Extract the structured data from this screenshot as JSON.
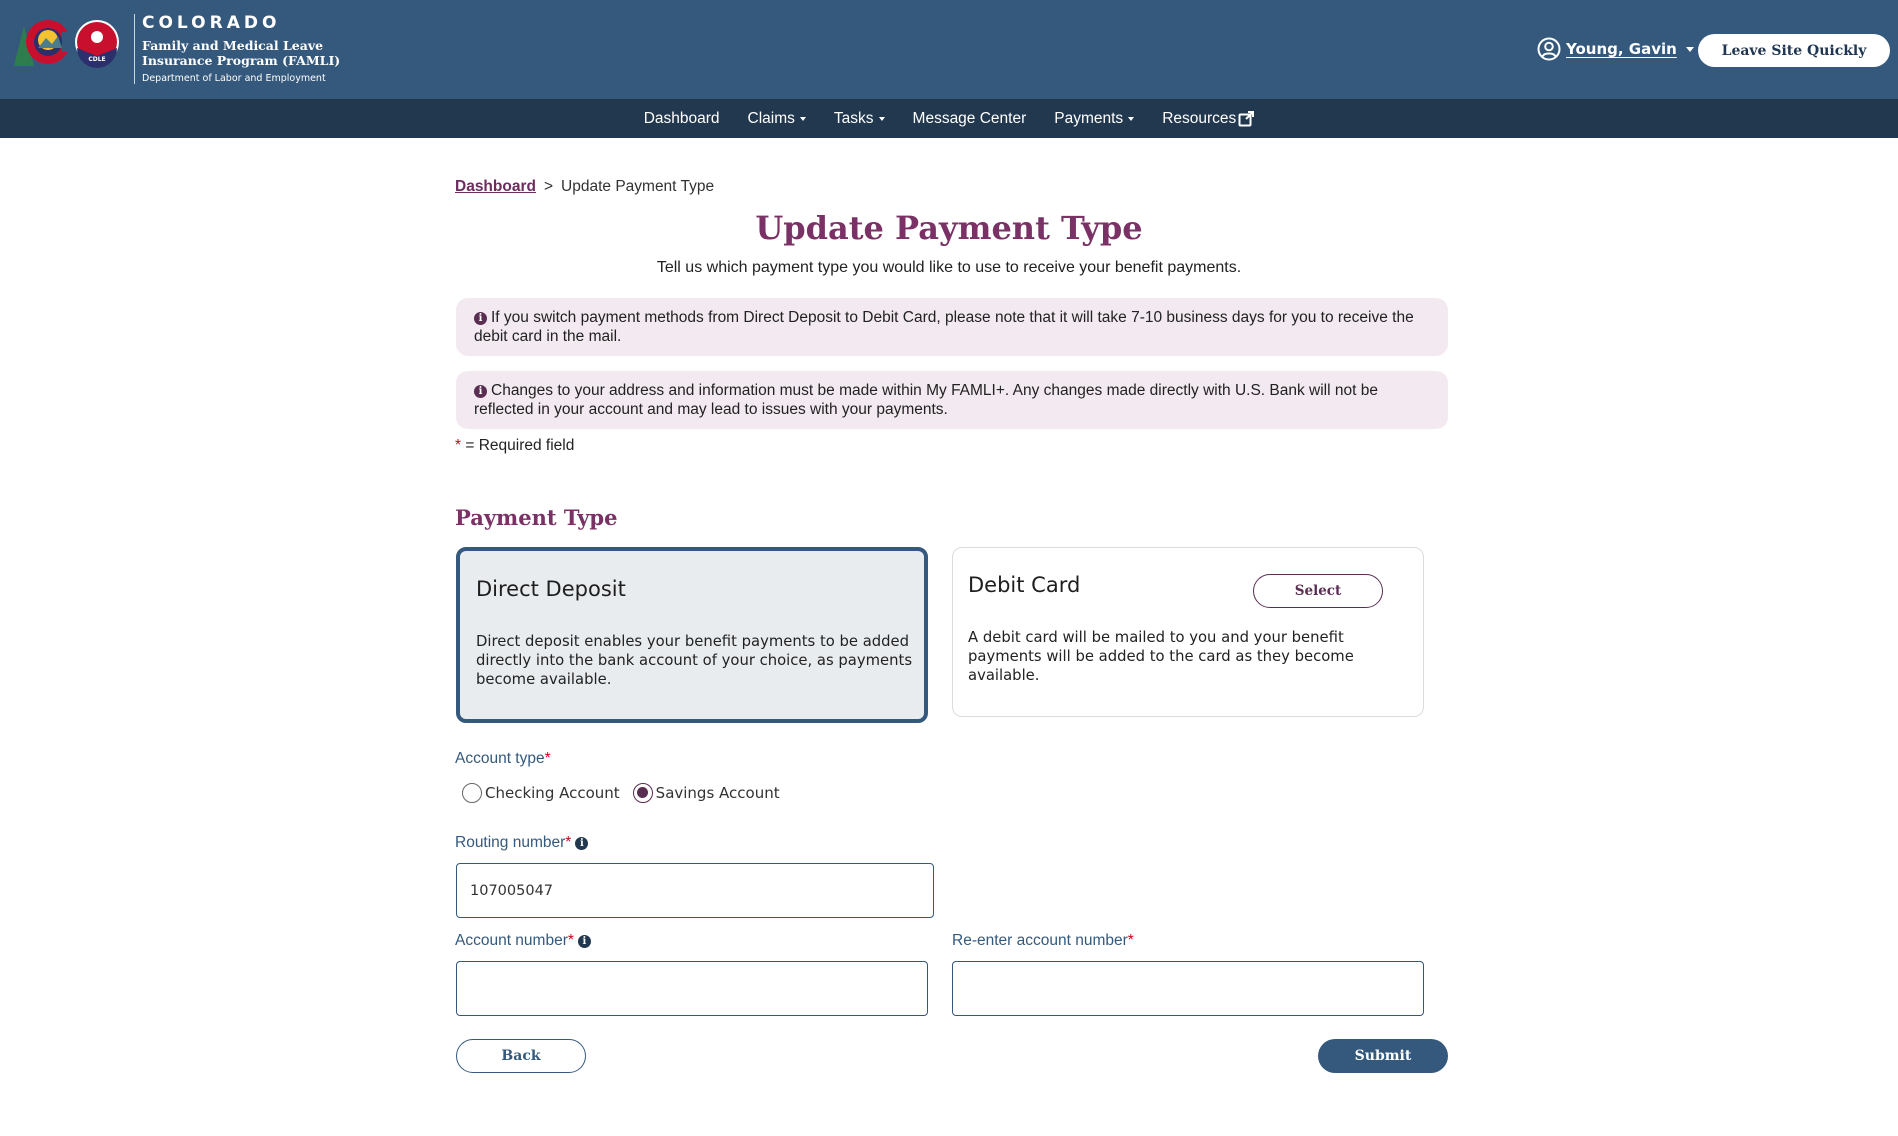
{
  "header": {
    "brand_state": "COLORADO",
    "brand_program_line1": "Family and Medical Leave",
    "brand_program_line2": "Insurance Program (FAMLI)",
    "brand_department": "Department of Labor and Employment",
    "logo_badge": "CDLE",
    "user_name": "Young, Gavin",
    "leave_button": "Leave Site Quickly"
  },
  "nav": {
    "items": [
      {
        "label": "Dashboard",
        "dropdown": false
      },
      {
        "label": "Claims",
        "dropdown": true
      },
      {
        "label": "Tasks",
        "dropdown": true
      },
      {
        "label": "Message Center",
        "dropdown": false
      },
      {
        "label": "Payments",
        "dropdown": true
      },
      {
        "label": "Resources",
        "dropdown": false,
        "external": true
      }
    ]
  },
  "breadcrumb": {
    "link": "Dashboard",
    "separator": ">",
    "current": "Update Payment Type"
  },
  "page": {
    "title": "Update Payment Type",
    "subtitle": "Tell us which payment type you would like to use to receive your benefit payments.",
    "alerts": [
      "If you switch payment methods from Direct Deposit to Debit Card, please note that it will take 7-10 business days for you to receive the debit card in the mail.",
      "Changes to your address and information must be made within My FAMLI+. Any changes made directly with U.S. Bank will not be reflected in your account and may lead to issues with your payments."
    ],
    "required_star": "*",
    "required_note": " = Required field"
  },
  "payment_type": {
    "section_title": "Payment Type",
    "options": [
      {
        "title": "Direct Deposit",
        "description": "Direct deposit enables your benefit payments to be added directly into the bank account of your choice, as payments become available.",
        "selected": true
      },
      {
        "title": "Debit Card",
        "description": "A debit card will be mailed to you and your benefit payments will be added to the card as they become available.",
        "selected": false,
        "select_button": "Select"
      }
    ]
  },
  "form": {
    "account_type_label": "Account type",
    "account_type_options": [
      {
        "label": "Checking Account",
        "checked": false
      },
      {
        "label": "Savings Account",
        "checked": true
      }
    ],
    "routing_label": "Routing number",
    "routing_value": "107005047",
    "account_label": "Account number",
    "account_value": "",
    "reenter_label": "Re-enter account number",
    "reenter_value": "",
    "required_star": "*",
    "back_button": "Back",
    "submit_button": "Submit"
  },
  "colors": {
    "header_bg": "#35597c",
    "nav_bg": "#22384f",
    "accent_purple": "#7a3166",
    "alert_bg": "#f3e9f0",
    "required_red": "#d0021b"
  }
}
